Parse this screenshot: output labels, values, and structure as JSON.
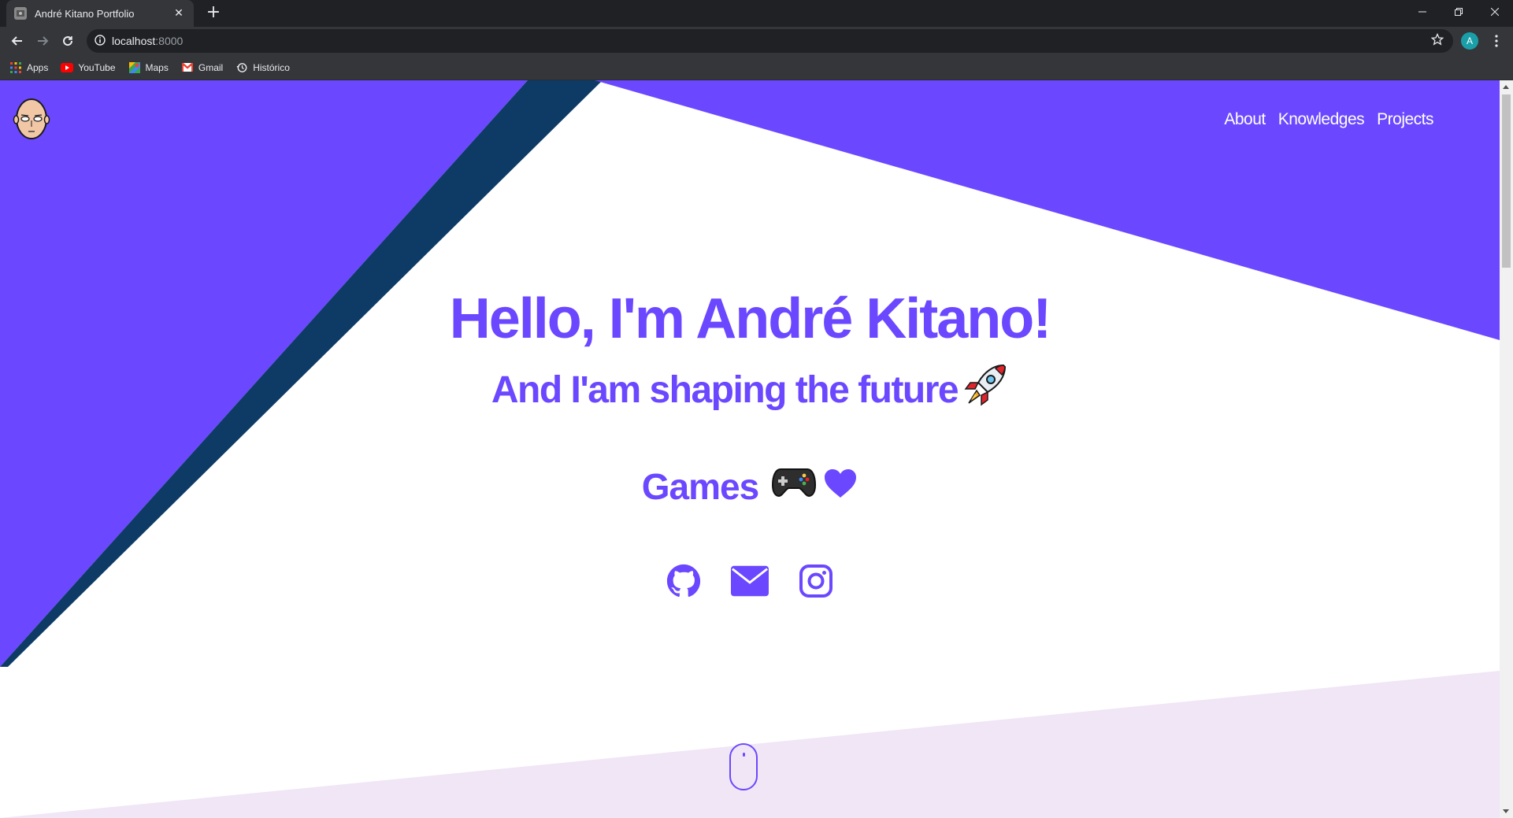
{
  "browser": {
    "tab_title": "André Kitano Portfolio",
    "url_host": "localhost",
    "url_port": ":8000",
    "profile_initial": "A",
    "bookmarks": [
      {
        "label": "Apps",
        "icon": "apps-grid-icon"
      },
      {
        "label": "YouTube",
        "icon": "youtube-icon"
      },
      {
        "label": "Maps",
        "icon": "maps-icon"
      },
      {
        "label": "Gmail",
        "icon": "gmail-icon"
      },
      {
        "label": "Histórico",
        "icon": "history-icon"
      }
    ]
  },
  "site": {
    "nav": [
      "About",
      "Knowledges",
      "Projects"
    ],
    "hero_title": "Hello, I'm André Kitano!",
    "hero_subtitle": "And I'am shaping the future",
    "hero_games": "Games",
    "socials": [
      {
        "name": "github-icon"
      },
      {
        "name": "email-icon"
      },
      {
        "name": "instagram-icon"
      }
    ]
  },
  "colors": {
    "primary": "#6b48ff",
    "dark_stripe": "#0d3b66",
    "lavender": "#f0e6f6",
    "chrome_dark": "#202124",
    "chrome_mid": "#35363a"
  }
}
